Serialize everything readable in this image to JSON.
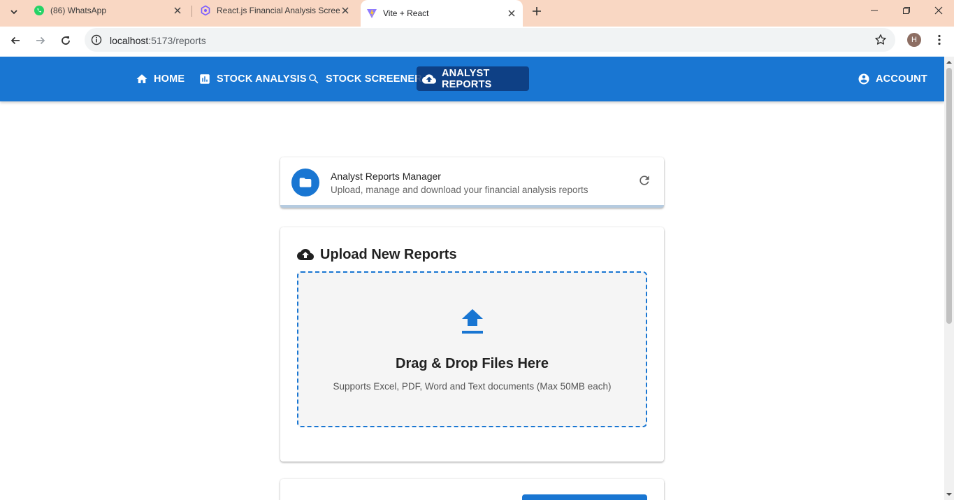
{
  "browser": {
    "tabs": [
      {
        "title": "(86) WhatsApp",
        "favicon": "whatsapp-icon"
      },
      {
        "title": "React.js Financial Analysis Scree",
        "favicon": "chatgpt-icon"
      },
      {
        "title": "Vite + React",
        "favicon": "vite-icon",
        "active": true
      }
    ],
    "url_host": "localhost",
    "url_path": ":5173/reports",
    "profile_initial": "H"
  },
  "nav": {
    "items": [
      {
        "label": "HOME",
        "icon": "home-icon"
      },
      {
        "label": "STOCK ANALYSIS",
        "icon": "chart-icon"
      },
      {
        "label": "STOCK SCREENER",
        "icon": "search-icon"
      },
      {
        "label": "ANALYST REPORTS",
        "icon": "cloud-upload-icon",
        "active": true
      }
    ],
    "account_label": "ACCOUNT"
  },
  "header_card": {
    "title": "Analyst Reports Manager",
    "subtitle": "Upload, manage and download your financial analysis reports"
  },
  "upload": {
    "title": "Upload New Reports",
    "dropzone_title": "Drag & Drop Files Here",
    "dropzone_subtitle": "Supports Excel, PDF, Word and Text documents (Max 50MB each)"
  },
  "colors": {
    "primary": "#1976d2",
    "active_nav": "#0d3778",
    "tab_strip": "#f9d7c3"
  }
}
